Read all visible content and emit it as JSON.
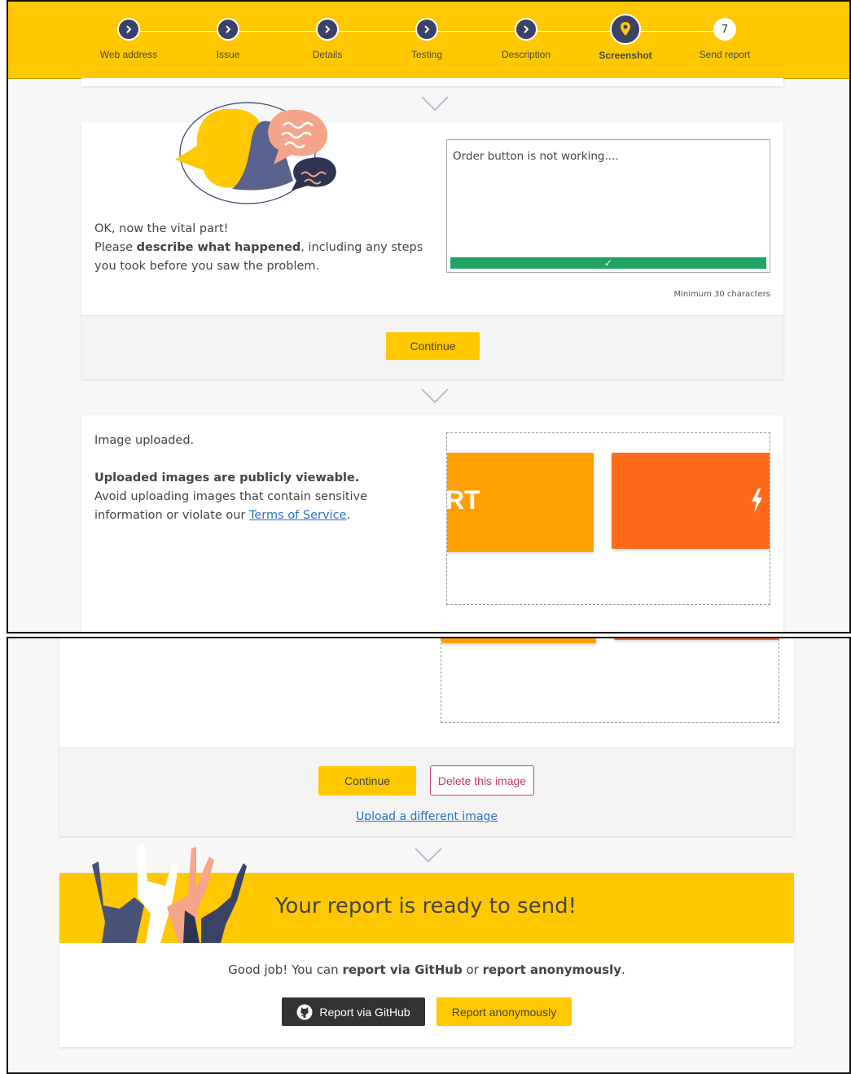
{
  "steps": [
    {
      "label": "Web address",
      "state": "done"
    },
    {
      "label": "Issue",
      "state": "done"
    },
    {
      "label": "Details",
      "state": "done"
    },
    {
      "label": "Testing",
      "state": "done"
    },
    {
      "label": "Description",
      "state": "done"
    },
    {
      "label": "Screenshot",
      "state": "active"
    },
    {
      "label": "Send report",
      "state": "next",
      "number": "7"
    }
  ],
  "description": {
    "intro": "OK, now the vital part!",
    "prompt_pre": "Please ",
    "prompt_bold": "describe what happened",
    "prompt_post": ", including any steps you took before you saw the problem.",
    "textarea_value": "Order button is not working....",
    "valid_mark": "✓",
    "min_hint": "Minimum 30 characters",
    "continue_label": "Continue"
  },
  "upload": {
    "status": "Image uploaded.",
    "warning_bold": "Uploaded images are publicly viewable.",
    "warning_text": "Avoid uploading images that contain sensitive information or violate our ",
    "tos_link": "Terms of Service",
    "tos_suffix": ".",
    "preview_text": "RT",
    "preview_icon": "lightning-icon",
    "continue_label": "Continue",
    "delete_label": "Delete this image",
    "upload_different_label": "Upload a different image"
  },
  "send": {
    "title": "Your report is ready to send!",
    "msg_pre": "Good job! You can ",
    "msg_bold1": "report via GitHub",
    "msg_mid": " or ",
    "msg_bold2": "report anonymously",
    "msg_post": ".",
    "github_label": "Report via GitHub",
    "github_icon": "github-icon",
    "anon_label": "Report anonymously"
  },
  "colors": {
    "brand_yellow": "#ffc800",
    "step_dark": "#3a4266",
    "success_green": "#21a366",
    "danger_pink": "#c0395f",
    "tile_orange": "#ffa000",
    "tile_red_orange": "#ff6a1a"
  }
}
